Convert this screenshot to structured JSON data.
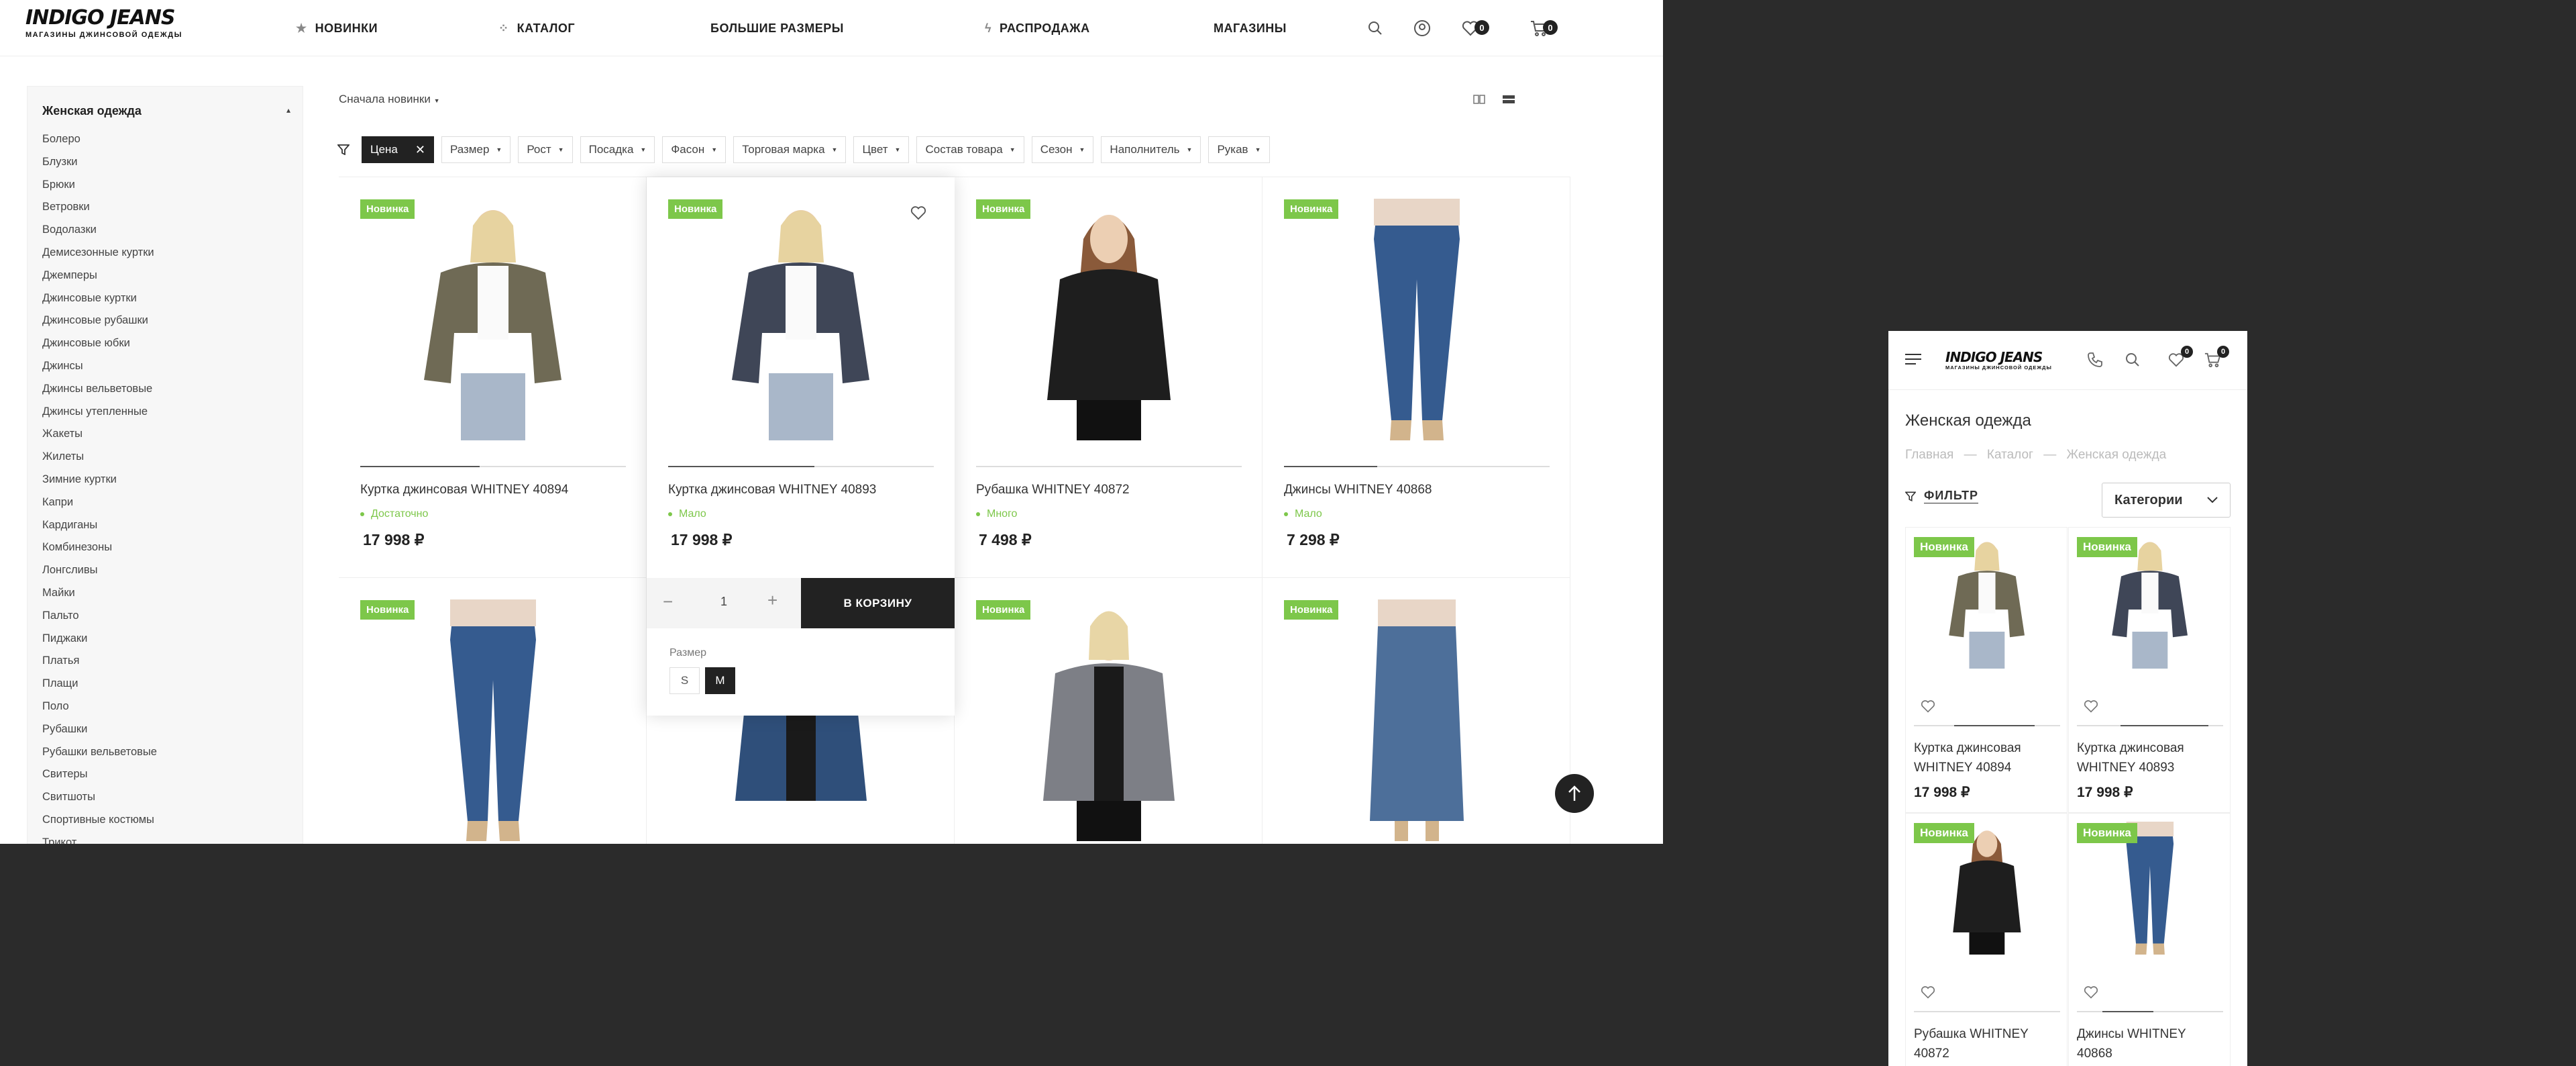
{
  "header": {
    "logo_main": "INDIGO JEANS",
    "logo_sub": "МАГАЗИНЫ ДЖИНСОВОЙ ОДЕЖДЫ",
    "nav": [
      "НОВИНКИ",
      "КАТАЛОГ",
      "БОЛЬШИЕ РАЗМЕРЫ",
      "РАСПРОДАЖА",
      "МАГАЗИНЫ"
    ],
    "favorites_count": "0",
    "cart_count": "0"
  },
  "sidebar": {
    "title": "Женская одежда",
    "items": [
      "Болеро",
      "Блузки",
      "Брюки",
      "Ветровки",
      "Водолазки",
      "Демисезонные куртки",
      "Джемперы",
      "Джинсовые куртки",
      "Джинсовые рубашки",
      "Джинсовые юбки",
      "Джинсы",
      "Джинсы вельветовые",
      "Джинсы утепленные",
      "Жакеты",
      "Жилеты",
      "Зимние куртки",
      "Капри",
      "Кардиганы",
      "Комбинезоны",
      "Лонгсливы",
      "Майки",
      "Пальто",
      "Пиджаки",
      "Платья",
      "Плащи",
      "Поло",
      "Рубашки",
      "Рубашки вельветовые",
      "Свитеры",
      "Свитшоты",
      "Спортивные костюмы",
      "Трикот"
    ]
  },
  "sort": {
    "label": "Сначала новинки"
  },
  "filters": {
    "active": "Цена",
    "chips": [
      "Размер",
      "Рост",
      "Посадка",
      "Фасон",
      "Торговая марка",
      "Цвет",
      "Состав товара",
      "Сезон",
      "Наполнитель",
      "Рукав"
    ]
  },
  "products": [
    {
      "badge": "Новинка",
      "name": "Куртка джинсовая WHITNEY 40894",
      "availability": "Достаточно",
      "price": "17 998 ₽",
      "slide_fraction": 0.45
    },
    {
      "badge": "Новинка",
      "name": "Куртка джинсовая WHITNEY 40893",
      "availability": "Мало",
      "price": "17 998 ₽",
      "slide_fraction": 0.55
    },
    {
      "badge": "Новинка",
      "name": "Рубашка WHITNEY 40872",
      "availability": "Много",
      "price": "7 498 ₽",
      "slide_fraction": 0
    },
    {
      "badge": "Новинка",
      "name": "Джинсы WHITNEY 40868",
      "availability": "Мало",
      "price": "7 298 ₽",
      "slide_fraction": 0.35
    },
    {
      "badge": "Новинка"
    },
    {
      "badge": "Новинка"
    },
    {
      "badge": "Новинка"
    },
    {
      "badge": "Новинка"
    }
  ],
  "hover_card": {
    "qty": "1",
    "cart_button": "В КОРЗИНУ",
    "size_label": "Размер",
    "sizes": [
      "S",
      "M"
    ],
    "selected_size": "M"
  },
  "mobile": {
    "logo_main": "INDIGO JEANS",
    "logo_sub": "МАГАЗИНЫ ДЖИНСОВОЙ ОДЕЖДЫ",
    "favorites_count": "0",
    "cart_count": "0",
    "title": "Женская одежда",
    "breadcrumb": [
      "Главная",
      "Каталог",
      "Женская одежда"
    ],
    "breadcrumb_sep": "—",
    "filter": "ФИЛЬТР",
    "categories": "Категории",
    "products": [
      {
        "badge": "Новинка",
        "name": "Куртка джинсовая WHITNEY 40894",
        "price": "17 998 ₽"
      },
      {
        "badge": "Новинка",
        "name": "Куртка джинсовая WHITNEY 40893",
        "price": "17 998 ₽"
      },
      {
        "badge": "Новинка",
        "name": "Рубашка WHITNEY 40872",
        "price": ""
      },
      {
        "badge": "Новинка",
        "name": "Джинсы WHITNEY 40868",
        "price": ""
      }
    ]
  }
}
